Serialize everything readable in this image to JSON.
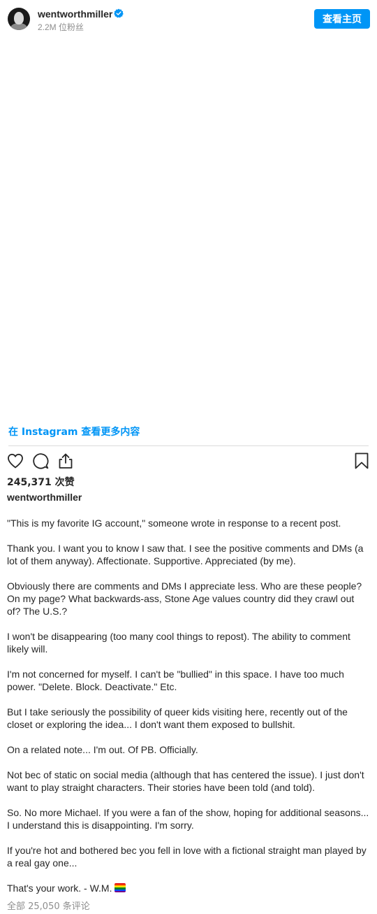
{
  "header": {
    "username": "wentworthmiller",
    "followers": "2.2M 位粉丝",
    "view_profile_label": "查看主页"
  },
  "view_more_label": "在 Instagram 查看更多内容",
  "actions": {
    "like_icon": "heart-icon",
    "comment_icon": "comment-icon",
    "share_icon": "share-icon",
    "save_icon": "bookmark-icon"
  },
  "likes_text": "245,371 次赞",
  "caption": {
    "username": "wentworthmiller",
    "paragraphs": [
      "\"This is my favorite IG account,\" someone wrote in response to a recent post.",
      "Thank you. I want you to know I saw that. I see the positive comments and DMs (a lot of them anyway). Affectionate. Supportive. Appreciated (by me).",
      "Obviously there are comments and DMs I appreciate less. Who are these people? On my page? What backwards-ass, Stone Age values country did they crawl out of? The U.S.?",
      "I won't be disappearing (too many cool things to repost). The ability to comment likely will.",
      "I'm not concerned for myself. I can't be \"bullied\" in this space. I have too much power. \"Delete. Block. Deactivate.\" Etc.",
      "But I take seriously the possibility of queer kids visiting here, recently out of the closet or exploring the idea... I don't want them exposed to bullshit.",
      "On a related note... I'm out. Of PB. Officially.",
      "Not bec of static on social media (although that has centered the issue). I just don't want to play straight characters. Their stories have been told (and told).",
      "So. No more Michael. If you were a fan of the show, hoping for additional seasons... I understand this is disappointing. I'm sorry.",
      "If you're hot and bothered bec you fell in love with a fictional straight man played by a real gay one...",
      "That's your work. - W.M."
    ]
  },
  "comments_text": "全部 25,050 条评论",
  "colors": {
    "accent": "#0095f6",
    "text": "#262626",
    "muted": "#8e8e8e",
    "divider": "#dbdbdb"
  }
}
